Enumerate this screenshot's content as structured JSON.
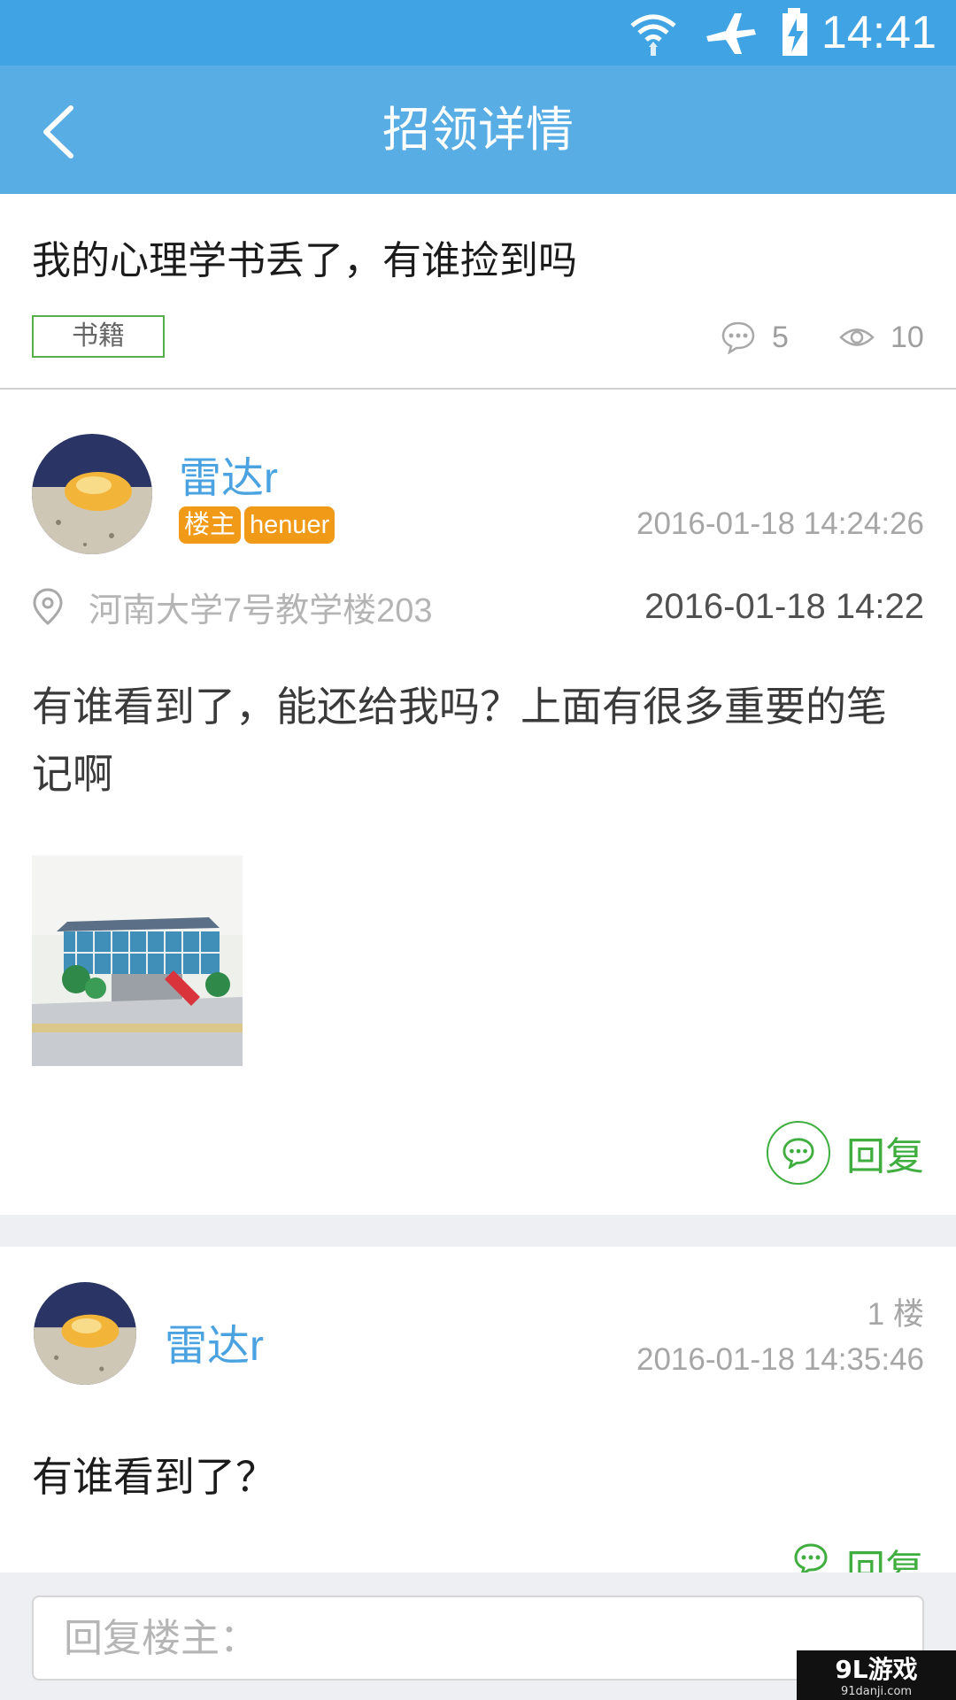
{
  "status_bar": {
    "time": "14:41",
    "icons": [
      "wifi-icon",
      "airplane-icon",
      "battery-charging-icon"
    ]
  },
  "app_bar": {
    "title": "招领详情",
    "back_icon": "back-arrow-icon"
  },
  "post": {
    "title": "我的心理学书丢了，有谁捡到吗",
    "category": "书籍",
    "comment_count": "5",
    "view_count": "10"
  },
  "owner_post": {
    "username": "雷达r",
    "badges": [
      "楼主",
      "henuer"
    ],
    "posted_at": "2016-01-18 14:24:26",
    "location": "河南大学7号教学楼203",
    "lost_time": "2016-01-18 14:22",
    "content": "有谁看到了，能还给我吗？上面有很多重要的笔记啊",
    "reply_label": "回复"
  },
  "comments": [
    {
      "username": "雷达r",
      "floor": "1 楼",
      "posted_at": "2016-01-18 14:35:46",
      "content": "有谁看到了？",
      "reply_label": "回复"
    }
  ],
  "reply_input": {
    "placeholder": "回复楼主：",
    "value": ""
  },
  "watermark": {
    "text": "9L游戏",
    "sub": "91danji.com"
  },
  "colors": {
    "status_bar": "#3fa3e4",
    "app_bar": "#57ade4",
    "accent_green": "#3fae3f",
    "badge_orange": "#f09a18",
    "username_blue": "#4aa3e0"
  }
}
